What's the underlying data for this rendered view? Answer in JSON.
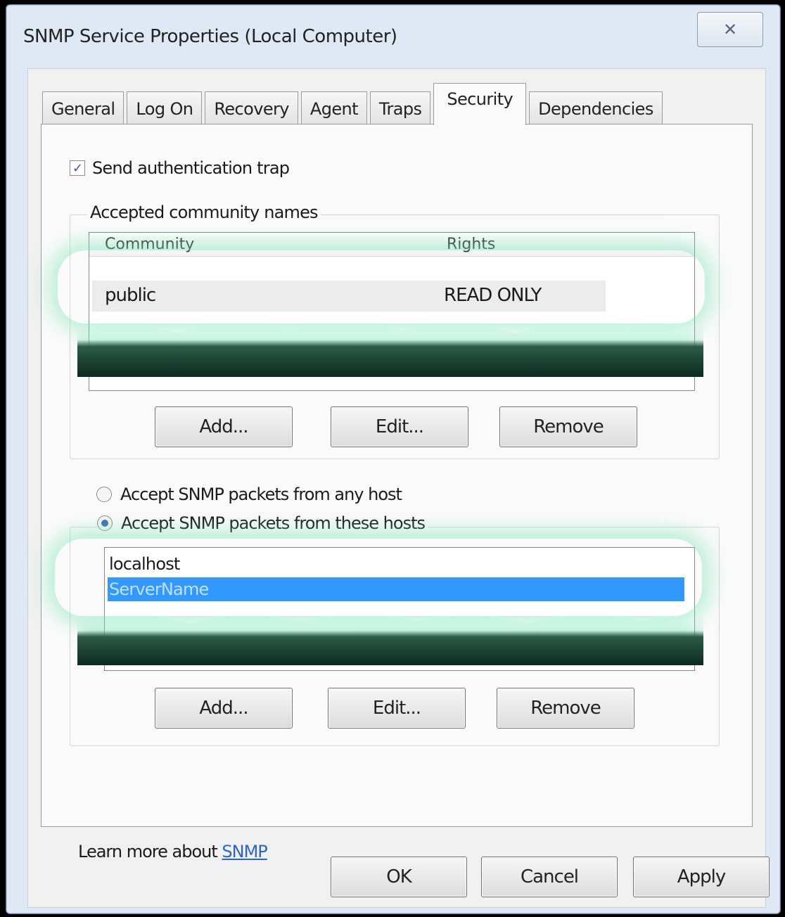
{
  "window": {
    "title": "SNMP Service Properties (Local Computer)",
    "close_glyph": "✕"
  },
  "tabs": [
    {
      "label": "General"
    },
    {
      "label": "Log On"
    },
    {
      "label": "Recovery"
    },
    {
      "label": "Agent"
    },
    {
      "label": "Traps"
    },
    {
      "label": "Security",
      "active": true
    },
    {
      "label": "Dependencies"
    }
  ],
  "security": {
    "send_auth_trap": {
      "label": "Send authentication trap",
      "checked": true,
      "check_glyph": "✓"
    },
    "communities": {
      "group_label": "Accepted community names",
      "columns": [
        "Community",
        "Rights"
      ],
      "rows": [
        {
          "community": "public",
          "rights": "READ ONLY"
        }
      ],
      "add_label": "Add...",
      "edit_label": "Edit...",
      "remove_label": "Remove"
    },
    "accept_any": {
      "label": "Accept SNMP packets from any host",
      "checked": false
    },
    "accept_these": {
      "label": "Accept SNMP packets from these hosts",
      "checked": true
    },
    "hosts": {
      "items": [
        {
          "name": "localhost",
          "selected": false
        },
        {
          "name": "ServerName",
          "selected": true
        }
      ],
      "add_label": "Add...",
      "edit_label": "Edit...",
      "remove_label": "Remove"
    },
    "learn_more": {
      "prefix": "Learn more about ",
      "link": "SNMP"
    }
  },
  "footer": {
    "ok_label": "OK",
    "cancel_label": "Cancel",
    "apply_label": "Apply"
  },
  "colors": {
    "selection": "#3399ff",
    "link": "#2a66c9",
    "glow": "#7fe0b8"
  }
}
